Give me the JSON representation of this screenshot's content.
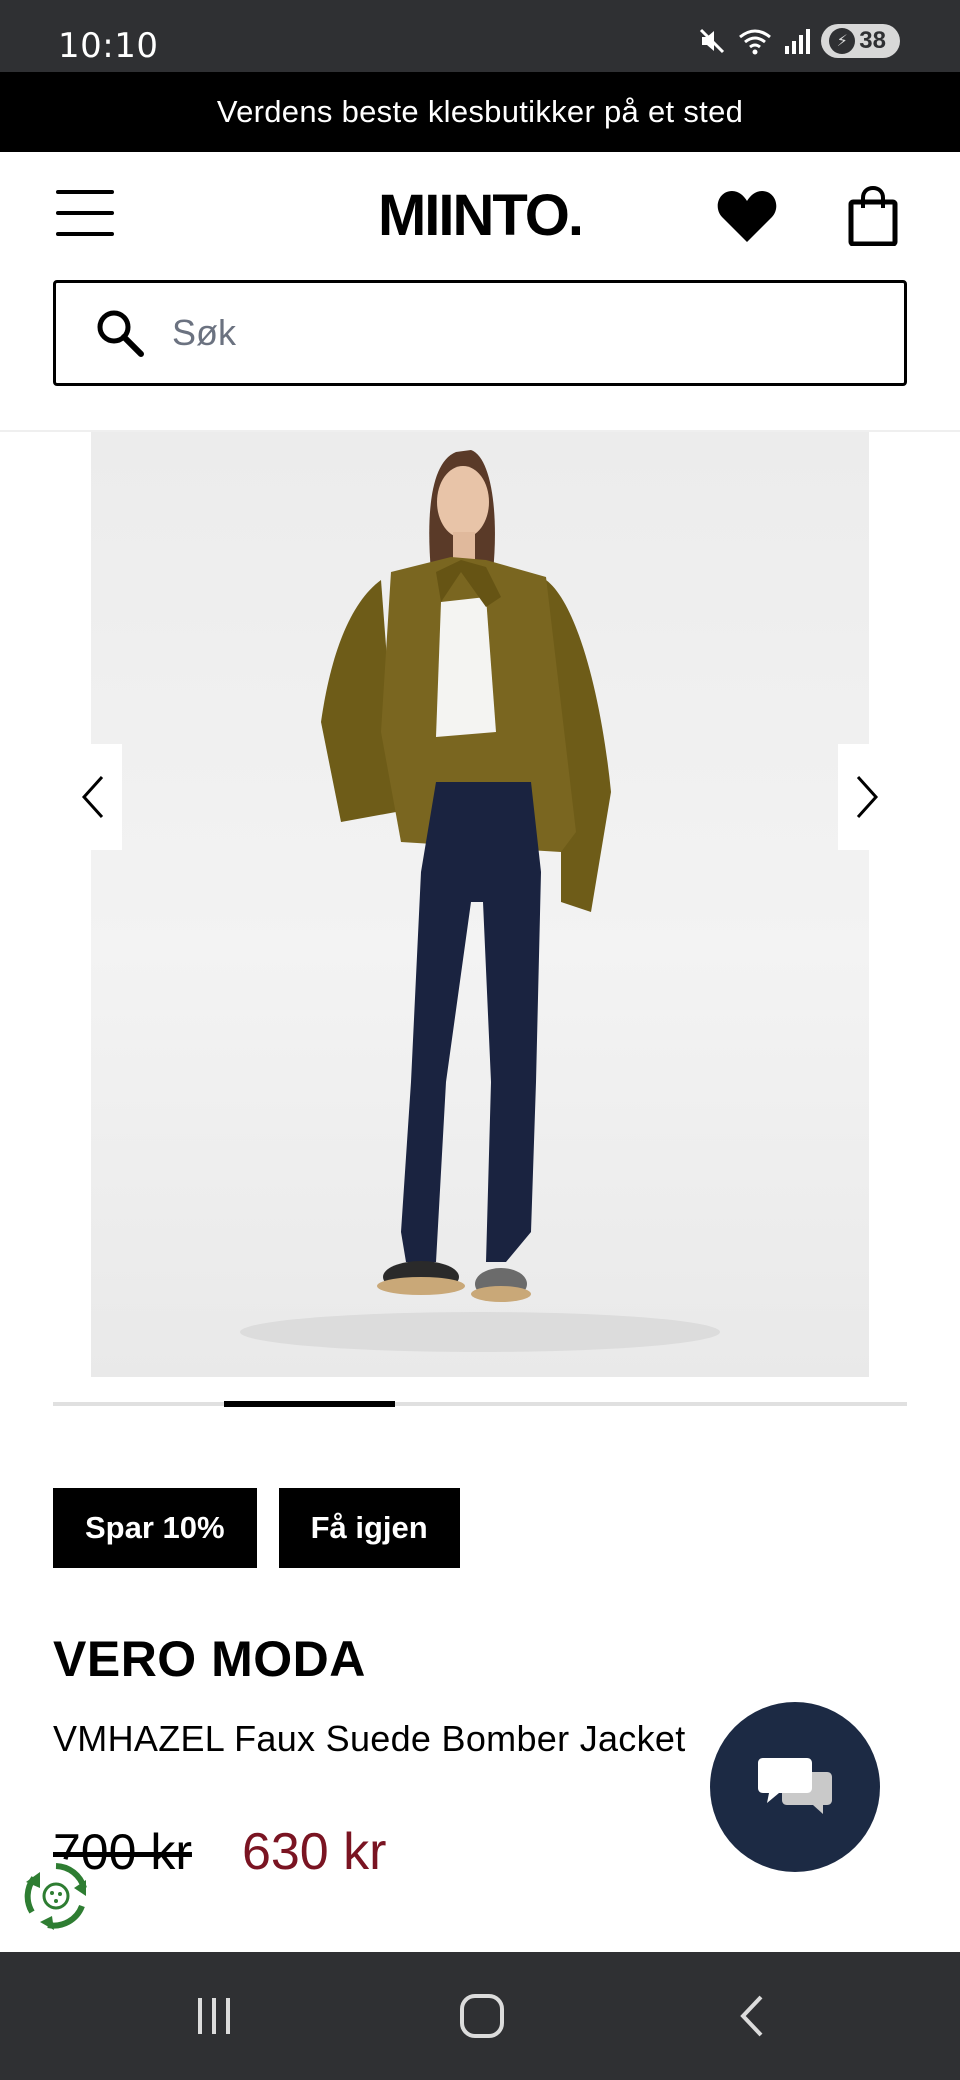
{
  "status_bar": {
    "time": "10:10",
    "battery": "38",
    "icons": [
      "mute-icon",
      "wifi-icon",
      "signal-icon",
      "battery-icon"
    ]
  },
  "promo_banner": {
    "text": "Verdens beste klesbutikker på et sted"
  },
  "header": {
    "logo": "MIINTO.",
    "icons": [
      "menu-icon",
      "heart-icon",
      "bag-icon"
    ]
  },
  "search": {
    "placeholder": "Søk",
    "value": ""
  },
  "gallery": {
    "current_index": 2,
    "total_images": 5,
    "icons": [
      "chevron-left-icon",
      "chevron-right-icon"
    ]
  },
  "badges": {
    "discount": "Spar 10%",
    "restock": "Få igjen"
  },
  "product": {
    "brand": "VERO MODA",
    "name": "VMHAZEL Faux Suede Bomber Jacket",
    "old_price": "700 kr",
    "new_price": "630 kr"
  },
  "colors": {
    "accent_price": "#7a1422",
    "chat_bg": "#1c2a44",
    "system_bar": "#2f3033"
  },
  "floating": {
    "chat_icon": "chat-bubbles-icon",
    "eco_icon": "recycle-icon"
  },
  "nav_bar": {
    "icons": [
      "recent-apps-icon",
      "home-icon",
      "back-icon"
    ]
  }
}
